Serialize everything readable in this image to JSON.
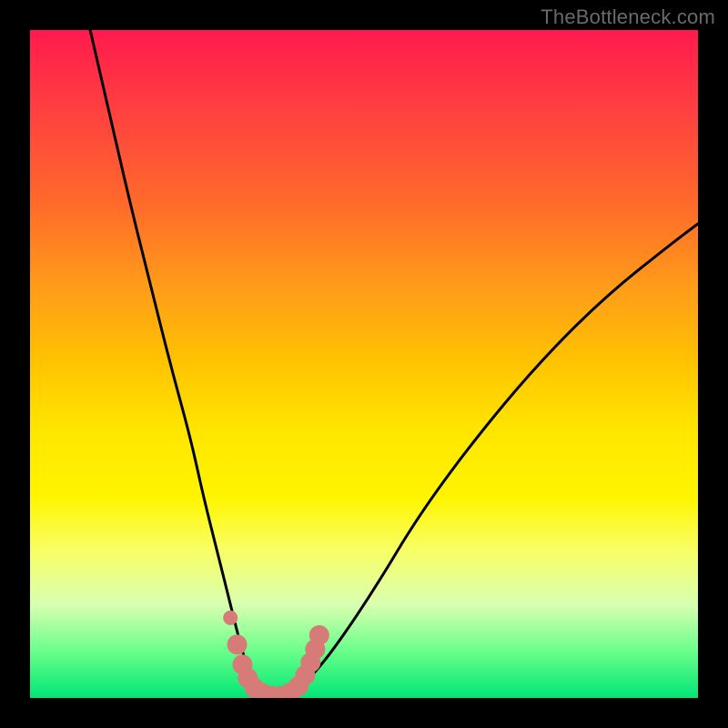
{
  "credit": "TheBottleneck.com",
  "colors": {
    "frame": "#000000",
    "gradient_top": "#ff1a4d",
    "gradient_mid": "#ffe600",
    "gradient_bottom": "#00e676",
    "curve": "#000000",
    "marker": "#d77b78"
  },
  "chart_data": {
    "type": "line",
    "title": "",
    "xlabel": "",
    "ylabel": "",
    "xlim": [
      0,
      100
    ],
    "ylim": [
      0,
      100
    ],
    "series": [
      {
        "name": "bottleneck-curve",
        "x": [
          9,
          12,
          15,
          18,
          21,
          24,
          26,
          28,
          30,
          31.5,
          33,
          35,
          37,
          39,
          42,
          46,
          52,
          58,
          66,
          76,
          86,
          96,
          100
        ],
        "values": [
          100,
          87,
          74,
          62,
          50,
          39,
          30,
          22,
          14,
          8,
          3,
          0,
          0,
          0.5,
          3,
          8,
          17,
          27,
          38,
          50,
          60,
          68,
          71
        ]
      }
    ],
    "markers": {
      "name": "highlight-dots",
      "color": "#d77b78",
      "points": [
        {
          "x": 30.0,
          "y": 12
        },
        {
          "x": 31.0,
          "y": 8
        },
        {
          "x": 31.8,
          "y": 5
        },
        {
          "x": 32.6,
          "y": 3
        },
        {
          "x": 33.6,
          "y": 1.5
        },
        {
          "x": 34.8,
          "y": 0.7
        },
        {
          "x": 36.2,
          "y": 0.3
        },
        {
          "x": 37.6,
          "y": 0.3
        },
        {
          "x": 39.0,
          "y": 0.8
        },
        {
          "x": 40.2,
          "y": 1.8
        },
        {
          "x": 41.2,
          "y": 3.4
        },
        {
          "x": 42.0,
          "y": 5.3
        },
        {
          "x": 42.7,
          "y": 7.3
        },
        {
          "x": 43.3,
          "y": 9.4
        }
      ]
    }
  }
}
